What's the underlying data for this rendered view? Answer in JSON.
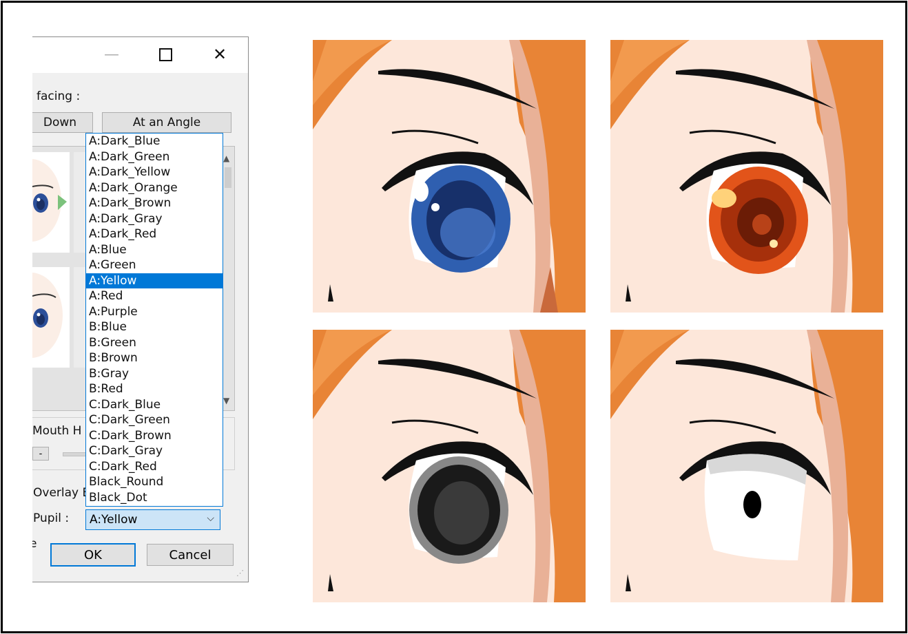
{
  "dialog": {
    "window_controls": {
      "minimize": "—",
      "maximize": "",
      "close": "✕"
    },
    "facing_label": "facing :",
    "down_button": "Down",
    "angle_button": "At an Angle",
    "mouth_label": "Mouth H",
    "minus_button": "-",
    "overlay_label": "Overlay E",
    "pupil_label": "Pupil :",
    "partial_label": "e",
    "pupil_selected": "A:Yellow",
    "ok_button": "OK",
    "cancel_button": "Cancel",
    "pupil_options": [
      "A:Dark_Blue",
      "A:Dark_Green",
      "A:Dark_Yellow",
      "A:Dark_Orange",
      "A:Dark_Brown",
      "A:Dark_Gray",
      "A:Dark_Red",
      "A:Blue",
      "A:Green",
      "A:Yellow",
      "A:Red",
      "A:Purple",
      "B:Blue",
      "B:Green",
      "B:Brown",
      "B:Gray",
      "B:Red",
      "C:Dark_Blue",
      "C:Dark_Green",
      "C:Dark_Brown",
      "C:Dark_Gray",
      "C:Dark_Red",
      "Black_Round",
      "Black_Dot"
    ]
  },
  "eye_tiles": [
    {
      "name": "blue-eye",
      "iris": "#2f5fb0",
      "iris_dark": "#17306a"
    },
    {
      "name": "orange-eye",
      "iris": "#e2541a",
      "iris_dark": "#6b1c06"
    },
    {
      "name": "gray-eye",
      "iris": "#555555",
      "iris_dark": "#1a1a1a"
    },
    {
      "name": "white-eye-black-dot",
      "iris": "#ffffff",
      "iris_dark": "#000000"
    }
  ],
  "colors": {
    "skin": "#fde7da",
    "hair": "#e88436",
    "hair_shadow": "#e9b197",
    "selection": "#0078d7"
  }
}
